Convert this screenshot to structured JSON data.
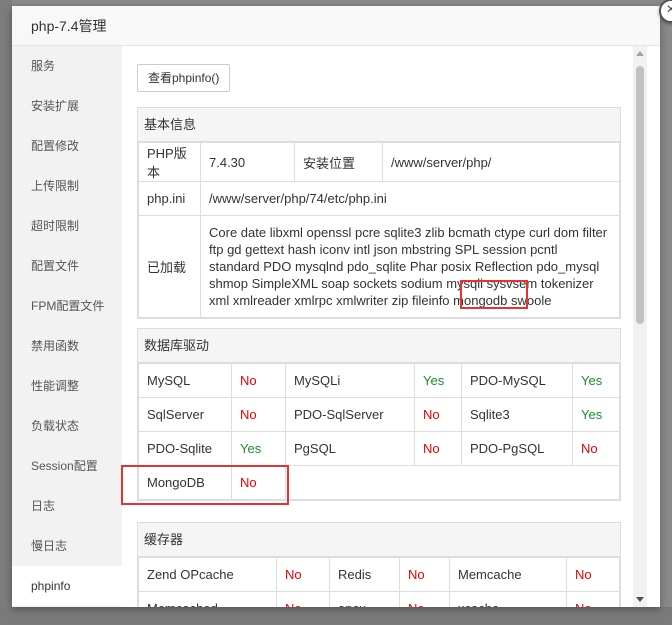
{
  "dialog": {
    "title": "php-7.4管理",
    "close_symbol": "×"
  },
  "sidebar": {
    "items": [
      {
        "label": "服务"
      },
      {
        "label": "安装扩展"
      },
      {
        "label": "配置修改"
      },
      {
        "label": "上传限制"
      },
      {
        "label": "超时限制"
      },
      {
        "label": "配置文件"
      },
      {
        "label": "FPM配置文件"
      },
      {
        "label": "禁用函数"
      },
      {
        "label": "性能调整"
      },
      {
        "label": "负载状态"
      },
      {
        "label": "Session配置"
      },
      {
        "label": "日志"
      },
      {
        "label": "慢日志"
      },
      {
        "label": "phpinfo",
        "active": true
      }
    ]
  },
  "toolbar": {
    "phpinfo_button": "查看phpinfo()"
  },
  "basic": {
    "title": "基本信息",
    "php_version_label": "PHP版本",
    "php_version": "7.4.30",
    "install_path_label": "安装位置",
    "install_path": "/www/server/php/",
    "ini_label": "php.ini",
    "ini_path": "/www/server/php/74/etc/php.ini",
    "loaded_label": "已加载",
    "loaded_pre": "Core date libxml openssl pcre sqlite3 zlib bcmath ctype curl dom filter ftp gd gettext hash iconv intl json mbstring SPL session pcntl standard PDO mysqlnd pdo_sqlite Phar posix Reflection pdo_mysql shmop SimpleXML soap sockets sodium mysqli sysvsem tokenizer xml xmlreader xmlrpc xmlwriter zip fileinfo ",
    "loaded_highlight": "mongodb",
    "loaded_post": " swoole"
  },
  "db_drivers": {
    "title": "数据库驱动",
    "rows": [
      [
        {
          "name": "MySQL",
          "status": "No"
        },
        {
          "name": "MySQLi",
          "status": "Yes"
        },
        {
          "name": "PDO-MySQL",
          "status": "Yes"
        }
      ],
      [
        {
          "name": "SqlServer",
          "status": "No"
        },
        {
          "name": "PDO-SqlServer",
          "status": "No"
        },
        {
          "name": "Sqlite3",
          "status": "Yes"
        }
      ],
      [
        {
          "name": "PDO-Sqlite",
          "status": "Yes"
        },
        {
          "name": "PgSQL",
          "status": "No"
        },
        {
          "name": "PDO-PgSQL",
          "status": "No"
        }
      ],
      [
        {
          "name": "MongoDB",
          "status": "No"
        }
      ]
    ]
  },
  "cache": {
    "title": "缓存器",
    "rows": [
      [
        {
          "name": "Zend OPcache",
          "status": "No"
        },
        {
          "name": "Redis",
          "status": "No"
        },
        {
          "name": "Memcache",
          "status": "No"
        }
      ],
      [
        {
          "name": "Memcached",
          "status": "No"
        },
        {
          "name": "apcu",
          "status": "No"
        },
        {
          "name": "xcache",
          "status": "No"
        }
      ]
    ]
  },
  "colors": {
    "yes": "#1a8f2e",
    "no": "#e00000",
    "highlight_box": "#e53333"
  }
}
